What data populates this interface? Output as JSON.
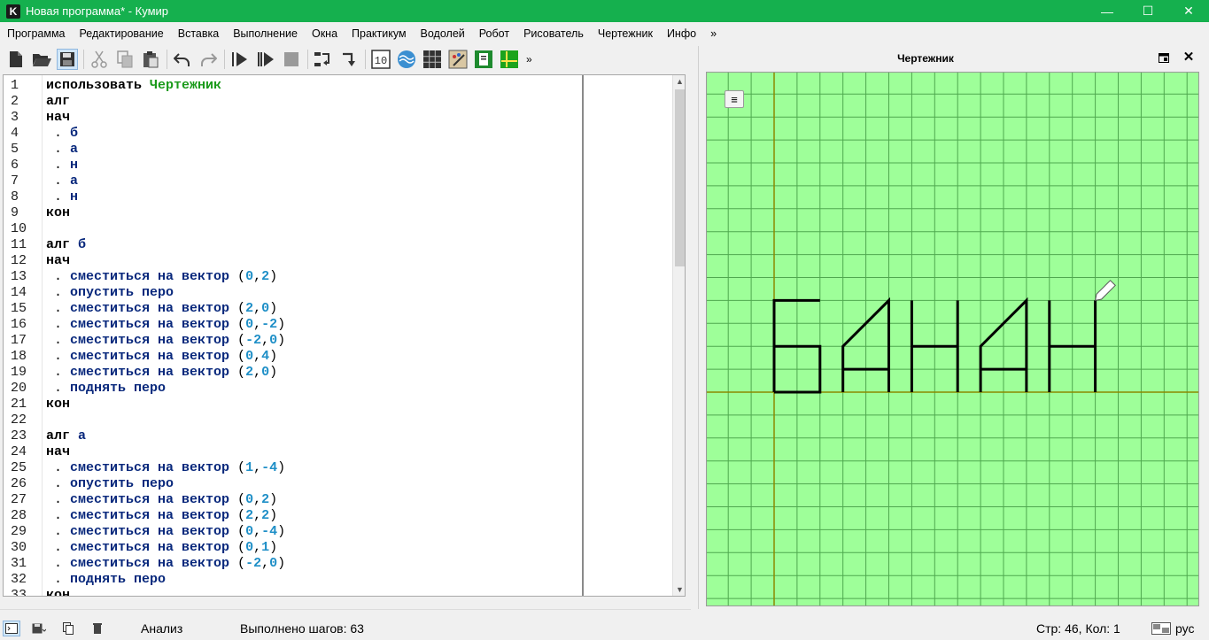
{
  "window": {
    "app_icon_letter": "K",
    "title": "Новая программа* - Кумир",
    "minimize": "—",
    "maximize": "☐",
    "close": "✕"
  },
  "menu": [
    "Программа",
    "Редактирование",
    "Вставка",
    "Выполнение",
    "Окна",
    "Практикум",
    "Водолей",
    "Робот",
    "Рисователь",
    "Чертежник",
    "Инфо",
    "»"
  ],
  "toolbar": {
    "buttons": [
      "new-file-icon",
      "open-folder-icon",
      "save-icon",
      "cut-icon",
      "copy-icon",
      "paste-icon",
      "undo-icon",
      "redo-icon",
      "run-icon",
      "run-step-icon",
      "stop-icon",
      "step-over-icon",
      "step-into-icon",
      "counter-icon",
      "waterer-icon",
      "robot-icon",
      "painter-icon",
      "book-icon",
      "drawer-icon"
    ],
    "more": "»"
  },
  "editor": {
    "lines": [
      {
        "n": "1",
        "t": [
          [
            "kw",
            "использовать "
          ],
          [
            "mod",
            "Чертежник"
          ]
        ]
      },
      {
        "n": "2",
        "t": [
          [
            "kw",
            "алг"
          ]
        ]
      },
      {
        "n": "3",
        "t": [
          [
            "kw",
            "нач"
          ]
        ]
      },
      {
        "n": "4",
        "t": [
          [
            "pun",
            " . "
          ],
          [
            "fn",
            "б"
          ]
        ]
      },
      {
        "n": "5",
        "t": [
          [
            "pun",
            " . "
          ],
          [
            "fn",
            "а"
          ]
        ]
      },
      {
        "n": "6",
        "t": [
          [
            "pun",
            " . "
          ],
          [
            "fn",
            "н"
          ]
        ]
      },
      {
        "n": "7",
        "t": [
          [
            "pun",
            " . "
          ],
          [
            "fn",
            "а"
          ]
        ]
      },
      {
        "n": "8",
        "t": [
          [
            "pun",
            " . "
          ],
          [
            "fn",
            "н"
          ]
        ]
      },
      {
        "n": "9",
        "t": [
          [
            "kw",
            "кон"
          ]
        ]
      },
      {
        "n": "10",
        "t": []
      },
      {
        "n": "11",
        "t": [
          [
            "kw",
            "алг "
          ],
          [
            "fn",
            "б"
          ]
        ]
      },
      {
        "n": "12",
        "t": [
          [
            "kw",
            "нач"
          ]
        ]
      },
      {
        "n": "13",
        "t": [
          [
            "pun",
            " . "
          ],
          [
            "fn",
            "сместиться на вектор "
          ],
          [
            "pun",
            "("
          ],
          [
            "num",
            "0"
          ],
          [
            "pun",
            ","
          ],
          [
            "num",
            "2"
          ],
          [
            "pun",
            ")"
          ]
        ]
      },
      {
        "n": "14",
        "t": [
          [
            "pun",
            " . "
          ],
          [
            "fn",
            "опустить перо"
          ]
        ]
      },
      {
        "n": "15",
        "t": [
          [
            "pun",
            " . "
          ],
          [
            "fn",
            "сместиться на вектор "
          ],
          [
            "pun",
            "("
          ],
          [
            "num",
            "2"
          ],
          [
            "pun",
            ","
          ],
          [
            "num",
            "0"
          ],
          [
            "pun",
            ")"
          ]
        ]
      },
      {
        "n": "16",
        "t": [
          [
            "pun",
            " . "
          ],
          [
            "fn",
            "сместиться на вектор "
          ],
          [
            "pun",
            "("
          ],
          [
            "num",
            "0"
          ],
          [
            "pun",
            ","
          ],
          [
            "num",
            "-2"
          ],
          [
            "pun",
            ")"
          ]
        ]
      },
      {
        "n": "17",
        "t": [
          [
            "pun",
            " . "
          ],
          [
            "fn",
            "сместиться на вектор "
          ],
          [
            "pun",
            "("
          ],
          [
            "num",
            "-2"
          ],
          [
            "pun",
            ","
          ],
          [
            "num",
            "0"
          ],
          [
            "pun",
            ")"
          ]
        ]
      },
      {
        "n": "18",
        "t": [
          [
            "pun",
            " . "
          ],
          [
            "fn",
            "сместиться на вектор "
          ],
          [
            "pun",
            "("
          ],
          [
            "num",
            "0"
          ],
          [
            "pun",
            ","
          ],
          [
            "num",
            "4"
          ],
          [
            "pun",
            ")"
          ]
        ]
      },
      {
        "n": "19",
        "t": [
          [
            "pun",
            " . "
          ],
          [
            "fn",
            "сместиться на вектор "
          ],
          [
            "pun",
            "("
          ],
          [
            "num",
            "2"
          ],
          [
            "pun",
            ","
          ],
          [
            "num",
            "0"
          ],
          [
            "pun",
            ")"
          ]
        ]
      },
      {
        "n": "20",
        "t": [
          [
            "pun",
            " . "
          ],
          [
            "fn",
            "поднять перо"
          ]
        ]
      },
      {
        "n": "21",
        "t": [
          [
            "kw",
            "кон"
          ]
        ]
      },
      {
        "n": "22",
        "t": []
      },
      {
        "n": "23",
        "t": [
          [
            "kw",
            "алг "
          ],
          [
            "fn",
            "а"
          ]
        ]
      },
      {
        "n": "24",
        "t": [
          [
            "kw",
            "нач"
          ]
        ]
      },
      {
        "n": "25",
        "t": [
          [
            "pun",
            " . "
          ],
          [
            "fn",
            "сместиться на вектор "
          ],
          [
            "pun",
            "("
          ],
          [
            "num",
            "1"
          ],
          [
            "pun",
            ","
          ],
          [
            "num",
            "-4"
          ],
          [
            "pun",
            ")"
          ]
        ]
      },
      {
        "n": "26",
        "t": [
          [
            "pun",
            " . "
          ],
          [
            "fn",
            "опустить перо"
          ]
        ]
      },
      {
        "n": "27",
        "t": [
          [
            "pun",
            " . "
          ],
          [
            "fn",
            "сместиться на вектор "
          ],
          [
            "pun",
            "("
          ],
          [
            "num",
            "0"
          ],
          [
            "pun",
            ","
          ],
          [
            "num",
            "2"
          ],
          [
            "pun",
            ")"
          ]
        ]
      },
      {
        "n": "28",
        "t": [
          [
            "pun",
            " . "
          ],
          [
            "fn",
            "сместиться на вектор "
          ],
          [
            "pun",
            "("
          ],
          [
            "num",
            "2"
          ],
          [
            "pun",
            ","
          ],
          [
            "num",
            "2"
          ],
          [
            "pun",
            ")"
          ]
        ]
      },
      {
        "n": "29",
        "t": [
          [
            "pun",
            " . "
          ],
          [
            "fn",
            "сместиться на вектор "
          ],
          [
            "pun",
            "("
          ],
          [
            "num",
            "0"
          ],
          [
            "pun",
            ","
          ],
          [
            "num",
            "-4"
          ],
          [
            "pun",
            ")"
          ]
        ]
      },
      {
        "n": "30",
        "t": [
          [
            "pun",
            " . "
          ],
          [
            "fn",
            "сместиться на вектор "
          ],
          [
            "pun",
            "("
          ],
          [
            "num",
            "0"
          ],
          [
            "pun",
            ","
          ],
          [
            "num",
            "1"
          ],
          [
            "pun",
            ")"
          ]
        ]
      },
      {
        "n": "31",
        "t": [
          [
            "pun",
            " . "
          ],
          [
            "fn",
            "сместиться на вектор "
          ],
          [
            "pun",
            "("
          ],
          [
            "num",
            "-2"
          ],
          [
            "pun",
            ","
          ],
          [
            "num",
            "0"
          ],
          [
            "pun",
            ")"
          ]
        ]
      },
      {
        "n": "32",
        "t": [
          [
            "pun",
            " . "
          ],
          [
            "fn",
            "поднять перо"
          ]
        ]
      },
      {
        "n": "33",
        "t": [
          [
            "kw",
            "кон"
          ]
        ]
      }
    ]
  },
  "drawer": {
    "title": "Чертежник",
    "dock_icon": "dock-icon",
    "close_label": "✕",
    "menu_icon": "≡",
    "colors": {
      "background": "#9eff99",
      "grid": "#4fa84f",
      "axis": "#8a8a00",
      "ink": "#000000"
    },
    "drawing": {
      "grid_step": 1,
      "origin_visible": true,
      "strokes": [
        [
          [
            0,
            0
          ],
          [
            0,
            4
          ],
          [
            2,
            4
          ]
        ],
        [
          [
            0,
            0
          ],
          [
            2,
            0
          ],
          [
            2,
            2
          ],
          [
            0,
            2
          ]
        ],
        [
          [
            3,
            0
          ],
          [
            3,
            2
          ],
          [
            5,
            4
          ],
          [
            5,
            0
          ]
        ],
        [
          [
            3,
            1
          ],
          [
            5,
            1
          ]
        ],
        [
          [
            6,
            0
          ],
          [
            6,
            4
          ]
        ],
        [
          [
            6,
            2
          ],
          [
            8,
            2
          ]
        ],
        [
          [
            8,
            0
          ],
          [
            8,
            4
          ]
        ],
        [
          [
            9,
            0
          ],
          [
            9,
            2
          ],
          [
            11,
            4
          ],
          [
            11,
            0
          ]
        ],
        [
          [
            9,
            1
          ],
          [
            11,
            1
          ]
        ],
        [
          [
            12,
            0
          ],
          [
            12,
            4
          ]
        ],
        [
          [
            12,
            2
          ],
          [
            14,
            2
          ]
        ],
        [
          [
            14,
            0
          ],
          [
            14,
            4
          ]
        ]
      ],
      "pen_at": [
        14,
        4
      ]
    }
  },
  "status": {
    "analysis": "Анализ",
    "steps": "Выполнено шагов: 63",
    "position": "Стр: 46, Кол: 1",
    "lang": "рус"
  }
}
